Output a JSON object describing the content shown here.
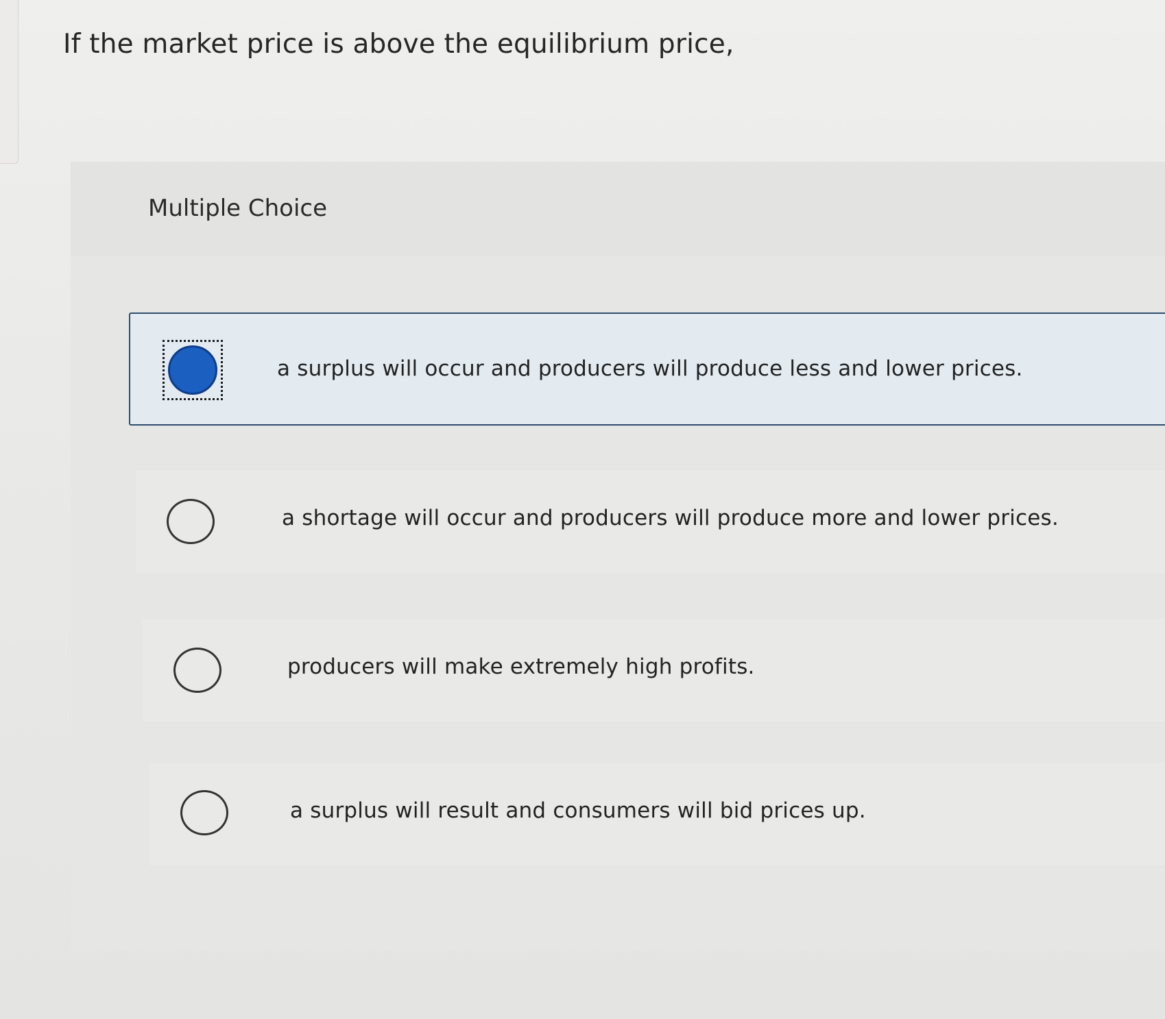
{
  "question": {
    "text": "If the market price is above the equilibrium price,"
  },
  "multiple_choice": {
    "label": "Multiple Choice",
    "selected_index": 0,
    "options": [
      {
        "text": "a surplus will occur and producers will produce less and lower prices.",
        "selected": true
      },
      {
        "text": "a shortage will occur and producers will produce more and lower prices.",
        "selected": false
      },
      {
        "text": "producers will make extremely high profits.",
        "selected": false
      },
      {
        "text": "a surplus will result and consumers will bid prices up.",
        "selected": false
      }
    ]
  },
  "colors": {
    "selected_fill": "#1b5fc1",
    "selected_border": "#2f4d6d",
    "selected_background": "#e3ebf1"
  },
  "icons": {
    "selected": "filled-radio-icon",
    "unselected": "radio-icon"
  }
}
